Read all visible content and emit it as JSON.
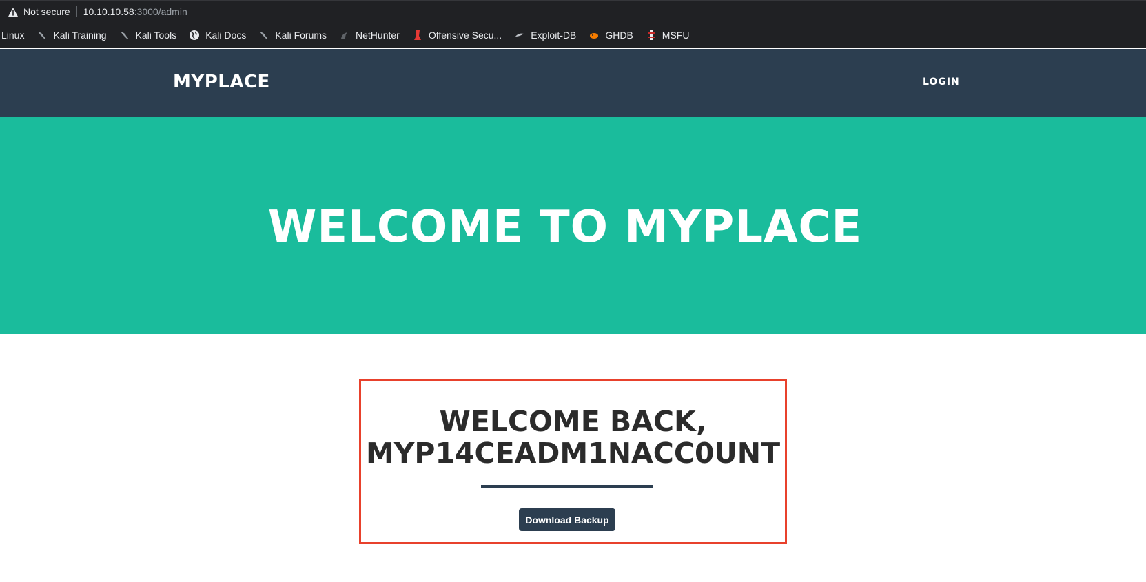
{
  "browser": {
    "security_label": "Not secure",
    "url_host": "10.10.10.58",
    "url_rest": ":3000/admin",
    "bookmarks": [
      {
        "label": "Linux",
        "icon": "none"
      },
      {
        "label": "Kali Training",
        "icon": "kali-dragon-icon"
      },
      {
        "label": "Kali Tools",
        "icon": "kali-dragon-icon"
      },
      {
        "label": "Kali Docs",
        "icon": "globe-icon"
      },
      {
        "label": "Kali Forums",
        "icon": "kali-dragon-icon"
      },
      {
        "label": "NetHunter",
        "icon": "nethunter-icon"
      },
      {
        "label": "Offensive Secu...",
        "icon": "offsec-icon"
      },
      {
        "label": "Exploit-DB",
        "icon": "exploitdb-icon"
      },
      {
        "label": "GHDB",
        "icon": "ghdb-icon"
      },
      {
        "label": "MSFU",
        "icon": "msfu-icon"
      }
    ]
  },
  "navbar": {
    "brand": "MYPLACE",
    "login": "LOGIN"
  },
  "hero": {
    "title": "WELCOME TO MYPLACE"
  },
  "panel": {
    "greeting_line1": "WELCOME BACK,",
    "greeting_line2": "MYP14CEADM1NACC0UNT",
    "button_label": "Download Backup"
  },
  "colors": {
    "navbar": "#2c3e50",
    "hero": "#1abc9c",
    "highlight_border": "#e8412c"
  }
}
